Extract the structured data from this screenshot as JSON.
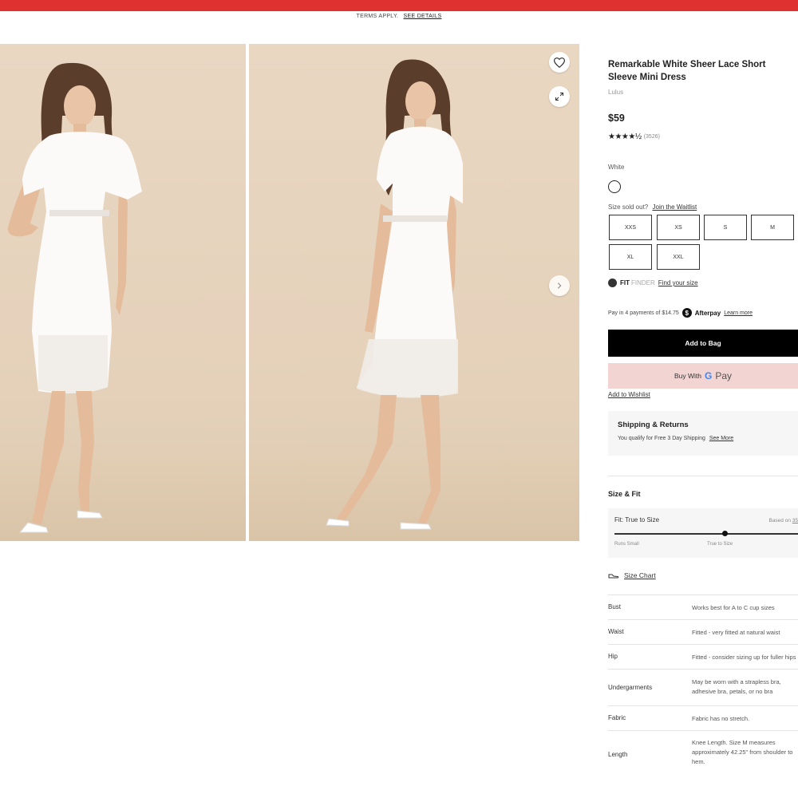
{
  "promo": {
    "terms": "TERMS APPLY.",
    "details_link": "SEE DETAILS"
  },
  "colors": {
    "promo_bar": "#e03131",
    "add_to_bag": "#000000",
    "gpay_bg": "#f2d4d2"
  },
  "gallery": {
    "wishlist_icon": "heart-icon",
    "expand_icon": "expand-icon",
    "next_icon": "chevron-right-icon"
  },
  "product": {
    "title": "Remarkable White Sheer Lace Short Sleeve Mini Dress",
    "brand": "Lulus",
    "price": "$59",
    "stars": "★★★★½",
    "review_count": "(3526)",
    "color_label": "White"
  },
  "sizes": {
    "sold_out_text": "Size sold out?",
    "waitlist_link": "Join the Waitlist",
    "options": [
      "XXS",
      "XS",
      "S",
      "M",
      "XL",
      "XXL"
    ]
  },
  "fit_finder": {
    "fit": "FIT",
    "finder": "FINDER",
    "link": "Find your size"
  },
  "afterpay": {
    "text": "Pay in 4 payments of $14.75",
    "brand": "Afterpay",
    "link": "Learn more"
  },
  "actions": {
    "add_to_bag": "Add to Bag",
    "buy_with": "Buy With",
    "gpay_g": "G",
    "gpay_pay": "Pay",
    "add_to_wishlist": "Add to Wishlist"
  },
  "shipping": {
    "title": "Shipping & Returns",
    "text": "You qualify for Free 3 Day Shipping",
    "link": "See More"
  },
  "size_fit": {
    "title": "Size & Fit",
    "fit_label": "Fit: True to Size",
    "based_on": "Based on",
    "based_count": "35",
    "runs_small": "Runs Small",
    "true_to_size": "True to Size",
    "fit_value": 0.6,
    "size_chart": "Size Chart"
  },
  "specs": [
    {
      "key": "Bust",
      "value": "Works best for A to C cup sizes"
    },
    {
      "key": "Waist",
      "value": "Fitted - very fitted at natural waist"
    },
    {
      "key": "Hip",
      "value": "Fitted - consider sizing up for fuller hips"
    },
    {
      "key": "Undergarments",
      "value": "May be worn with a strapless bra, adhesive bra, petals, or no bra"
    },
    {
      "key": "Fabric",
      "value": "Fabric has no stretch."
    },
    {
      "key": "Length",
      "value": "Knee Length. Size M measures approximately 42.25\" from shoulder to hem."
    }
  ]
}
